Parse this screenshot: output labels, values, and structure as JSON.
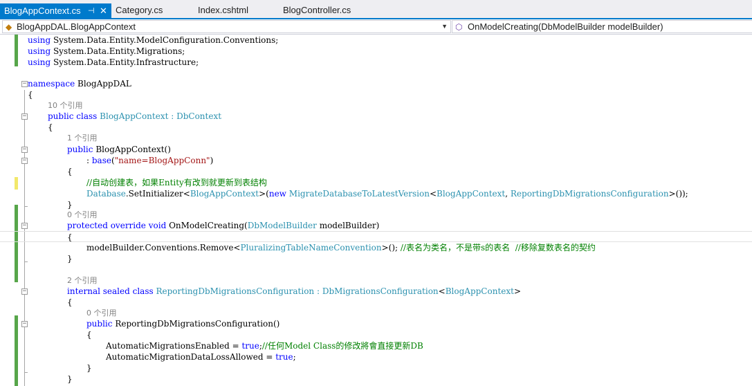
{
  "tabs": {
    "active": {
      "label": "BlogAppContext.cs",
      "pin": "⊣",
      "close": "✕"
    },
    "others": [
      "Category.cs",
      "Index.cshtml",
      "BlogController.cs"
    ]
  },
  "nav": {
    "project_combo": "BlogAppDAL.BlogAppContext",
    "member_combo": "OnModelCreating(DbModelBuilder modelBuilder)"
  },
  "icons": {
    "tab_pin": "pin-icon",
    "tab_close": "close-icon",
    "project": "class-icon",
    "member": "method-icon",
    "dropdown": "chevron-down-icon"
  },
  "colors": {
    "accent": "#007acc",
    "keyword": "#0000ff",
    "type": "#2b91af",
    "string": "#a31515",
    "comment": "#008000",
    "changed_saved": "#57a64a"
  },
  "code": {
    "l1_kw": "using",
    "l1_rest": " System.Data.Entity.ModelConfiguration.Conventions;",
    "l2_kw": "using",
    "l2_rest": " System.Data.Entity.Migrations;",
    "l3_kw": "using",
    "l3_rest": " System.Data.Entity.Infrastructure;",
    "ns_kw": "namespace",
    "ns_name": " BlogAppDAL",
    "brace_open": "{",
    "brace_close": "}",
    "ref10": "10 个引用",
    "class1_kw": "public class",
    "class1_name": "BlogAppContext",
    "class1_sep": " : ",
    "class1_base": "DbContext",
    "ref1": "1 个引用",
    "ctor_kw": "public",
    "ctor_name": " BlogAppContext()",
    "base_pre": ": ",
    "base_kw": "base",
    "base_open": "(",
    "base_str": "\"name=BlogAppConn\"",
    "base_close": ")",
    "cm_create": "//自动创建表，如果Entity有改到就更新到表结构",
    "db_ty": "Database",
    "db_call": ".SetInitializer<",
    "db_t1": "BlogAppContext",
    "db_new_pre": ">(",
    "db_new_kw": "new",
    "db_t2": "MigrateDatabaseToLatestVersion",
    "db_lt": "<",
    "db_t3": "BlogAppContext",
    "db_comma": ", ",
    "db_t4": "ReportingDbMigrationsConfiguration",
    "db_end": ">());",
    "ref0a": "0 个引用",
    "omc_kw": "protected override void",
    "omc_name": " OnModelCreating(",
    "omc_ty": "DbModelBuilder",
    "omc_param": " modelBuilder)",
    "remove_pre": "modelBuilder.Conventions.Remove<",
    "remove_ty": "PluralizingTableNameConvention",
    "remove_post": ">(); ",
    "remove_cm": "//表名为类名，不是带s的表名  //移除复数表名的契约",
    "ref2": "2 个引用",
    "class2_kw": "internal sealed class",
    "class2_name": "ReportingDbMigrationsConfiguration",
    "class2_sep": " : ",
    "class2_base": "DbMigrationsConfiguration",
    "class2_lt": "<",
    "class2_t": "BlogAppContext",
    "class2_gt": ">",
    "ref0b": "0 个引用",
    "ctor2_kw": "public",
    "ctor2_name": " ReportingDbMigrationsConfiguration()",
    "ame_pre": "AutomaticMigrationsEnabled = ",
    "ame_kw": "true",
    "ame_post": ";",
    "ame_cm": "//任何Model Class的修改將會直接更新DB",
    "amdl_pre": "AutomaticMigrationDataLossAllowed = ",
    "amdl_kw": "true",
    "amdl_post": ";"
  }
}
